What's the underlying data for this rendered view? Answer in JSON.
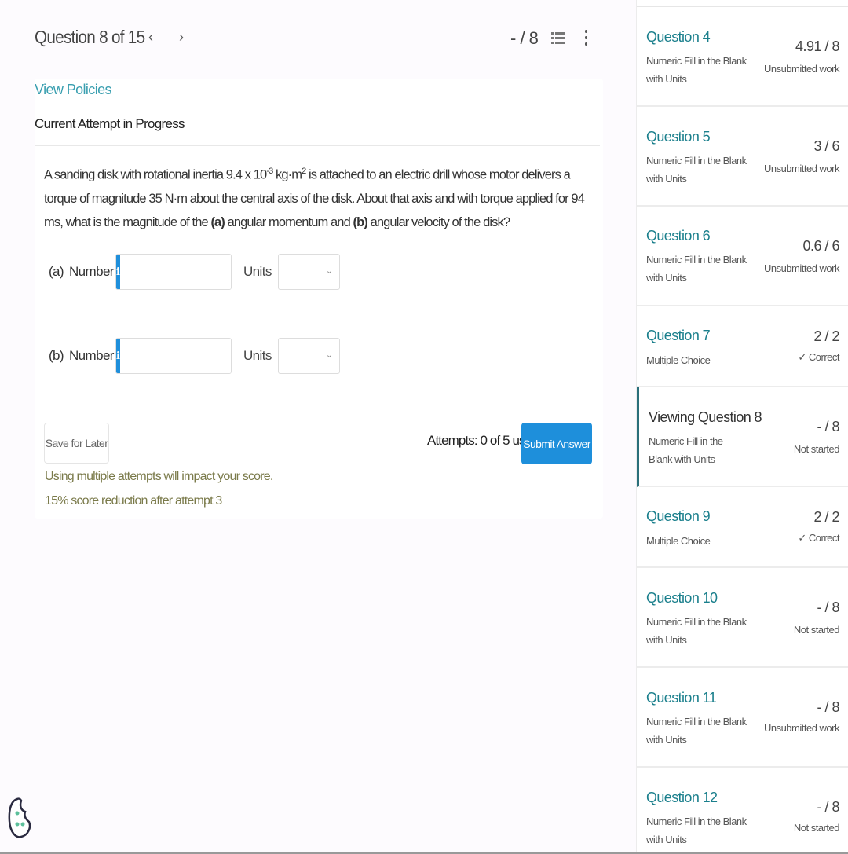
{
  "header": {
    "title": "Question 8 of 15",
    "prev_icon": "chevron-left-icon",
    "next_icon": "chevron-right-icon",
    "score": "- / 8",
    "list_icon": "numbered-list-icon",
    "menu_icon": "kebab-menu-icon"
  },
  "policies_link": "View Policies",
  "attempt_heading": "Current Attempt in Progress",
  "question": {
    "text_before_exp": "A sanding disk with rotational inertia 9.4 x 10",
    "exp1": "-3",
    "text_mid": " kg·m",
    "exp2": "2",
    "text_after": " is attached to an electric drill whose motor delivers a torque of magnitude 35 N·m about the central axis of the disk. About that axis and with torque applied for 94 ms, what is the magnitude of the ",
    "part_a_marker": "(a)",
    "text_between": " angular momentum and ",
    "part_b_marker": "(b)",
    "text_end": " angular velocity of the disk?"
  },
  "answers": [
    {
      "part": "(a)",
      "number_label": "Number",
      "info_icon": "i",
      "value": "",
      "units_label": "Units",
      "units_value": ""
    },
    {
      "part": "(b)",
      "number_label": "Number",
      "info_icon": "i",
      "value": "",
      "units_label": "Units",
      "units_value": ""
    }
  ],
  "actions": {
    "save_label": "Save for Later",
    "attempts_text": "Attempts: 0 of 5 used",
    "submit_label": "Submit Answer"
  },
  "warnings": [
    "Using multiple attempts will impact your score.",
    "15% score reduction after attempt 3"
  ],
  "sidebar": {
    "items": [
      {
        "title": "Question 4",
        "type": "Numeric Fill in the Blank with Units",
        "score": "4.91 / 8",
        "status": "Unsubmitted work",
        "active": false
      },
      {
        "title": "Question 5",
        "type": "Numeric Fill in the Blank with Units",
        "score": "3 / 6",
        "status": "Unsubmitted work",
        "active": false
      },
      {
        "title": "Question 6",
        "type": "Numeric Fill in the Blank with Units",
        "score": "0.6 / 6",
        "status": "Unsubmitted work",
        "active": false
      },
      {
        "title": "Question 7",
        "type": "Multiple Choice",
        "score": "2 / 2",
        "status": "✓ Correct",
        "active": false
      },
      {
        "title": "Viewing Question 8",
        "type": "Numeric Fill in the Blank with Units",
        "score": "- / 8",
        "status": "Not started",
        "active": true
      },
      {
        "title": "Question 9",
        "type": "Multiple Choice",
        "score": "2 / 2",
        "status": "✓ Correct",
        "active": false
      },
      {
        "title": "Question 10",
        "type": "Numeric Fill in the Blank with Units",
        "score": "- / 8",
        "status": "Not started",
        "active": false
      },
      {
        "title": "Question 11",
        "type": "Numeric Fill in the Blank with Units",
        "score": "- / 8",
        "status": "Unsubmitted work",
        "active": false
      },
      {
        "title": "Question 12",
        "type": "Numeric Fill in the Blank with Units",
        "score": "- / 8",
        "status": "Not started",
        "active": false
      }
    ]
  },
  "colors": {
    "accent_blue": "#1e8fdb",
    "teal_link": "#1a7f8c",
    "warning_text": "#7a7a4a"
  }
}
